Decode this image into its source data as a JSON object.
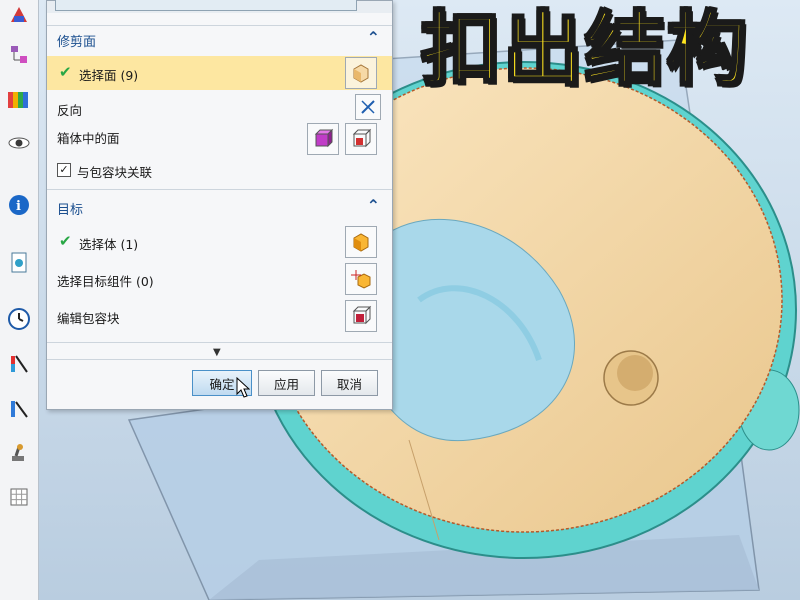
{
  "overlay": {
    "title": "扣出结构"
  },
  "dialog": {
    "trim_face": {
      "title": "修剪面",
      "select_face_label": "选择面 (9)",
      "reverse_label": "反向",
      "faces_in_body_label": "箱体中的面",
      "associate_box_label": "与包容块关联",
      "associate_box_checked": true
    },
    "target": {
      "title": "目标",
      "select_body_label": "选择体 (1)",
      "select_target_component_label": "选择目标组件 (0)",
      "edit_bounding_box_label": "编辑包容块"
    },
    "buttons": {
      "ok": "确定",
      "apply": "应用",
      "cancel": "取消"
    }
  },
  "colors": {
    "highlight_row": "#fde7a1",
    "section_title": "#1b4f8f",
    "title_text": "#ffe51f",
    "model_face": "#f0d7a8",
    "model_rim": "#5fd3cf"
  }
}
